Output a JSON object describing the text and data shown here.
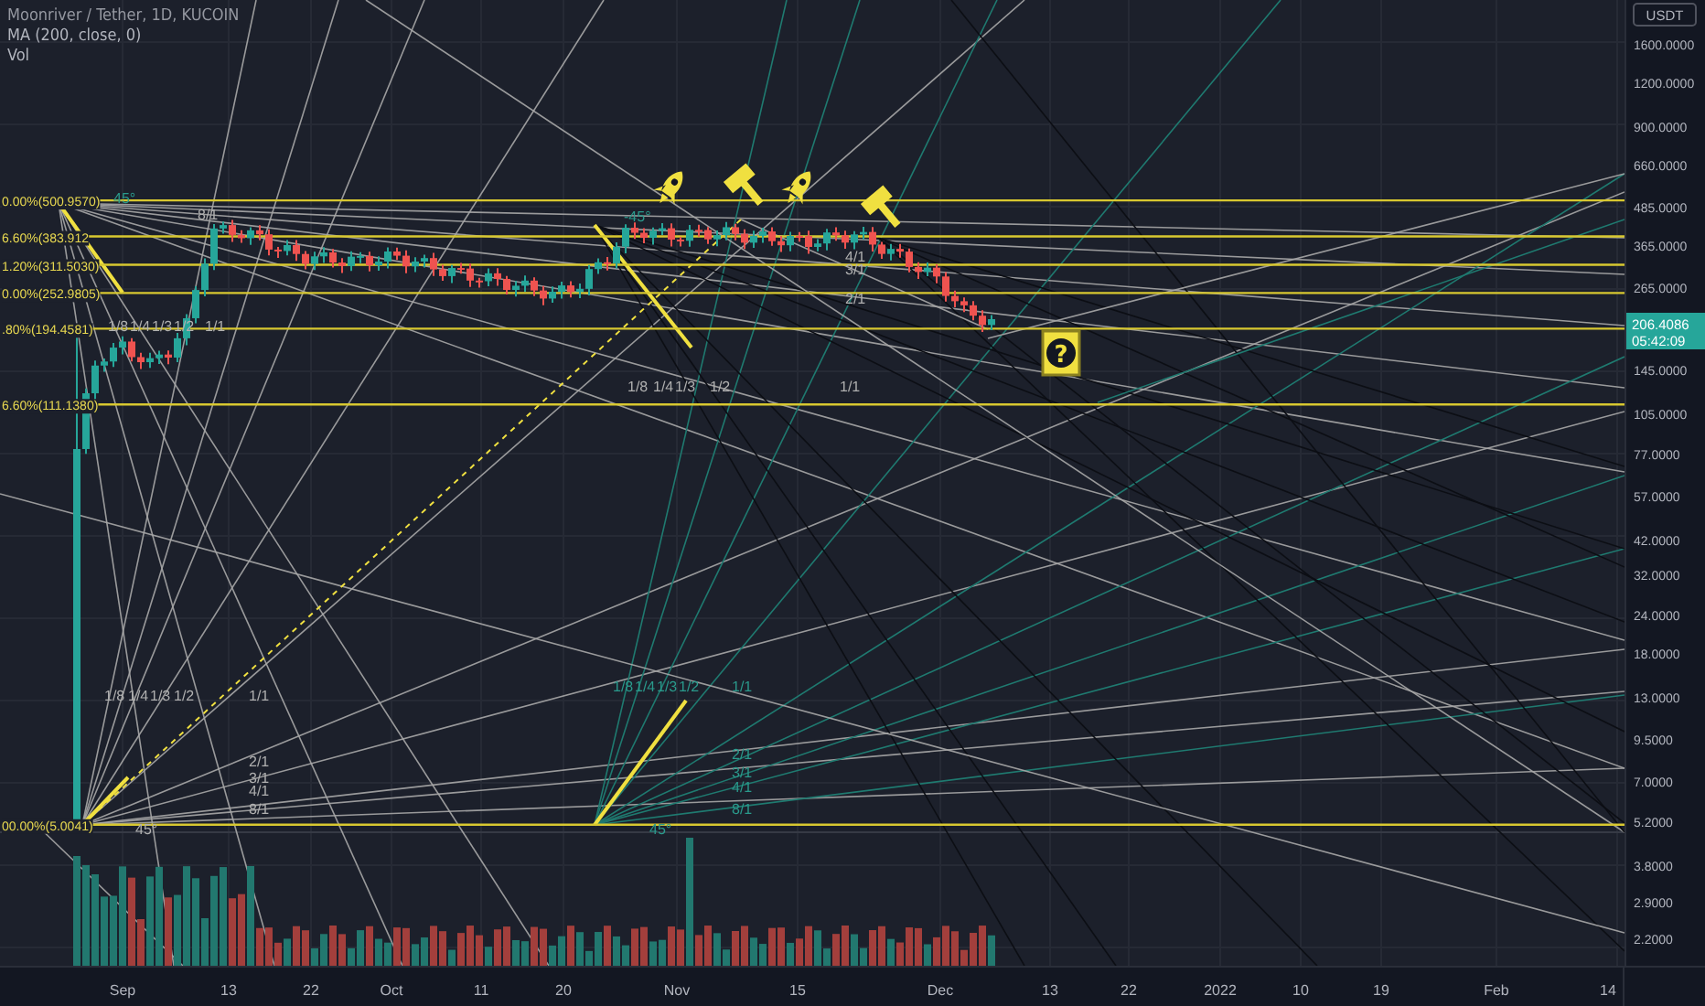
{
  "chart": {
    "legend": [
      "Moonriver / Tether, 1D, KUCOIN",
      "MA (200, close, 0)",
      "Vol"
    ],
    "fib_levels": [
      {
        "label": "0.00%(500.9570)"
      },
      {
        "label": "6.60%(383.912"
      },
      {
        "label": "1.20%(311.5030)"
      },
      {
        "label": "0.00%(252.9805)"
      },
      {
        "label": ".80%(194.4581)"
      },
      {
        "label": "6.60%(111.1380)"
      },
      {
        "label": "00.00%(5.0041)"
      }
    ],
    "fan_labels": [
      "1/8",
      "1/4",
      "1/3",
      "1/2",
      "1/1",
      "2/1",
      "3/1",
      "4/1",
      "8/1",
      "45°",
      "1/8",
      "1/4",
      "1/3",
      "1/2",
      "1/1",
      "2/1",
      "3/1",
      "4/1",
      "8/1",
      "45°",
      "8/1",
      "1/8",
      "1/4",
      "1/3",
      "1/2",
      "1/1",
      "45°",
      "-45°",
      "4/1",
      "3/1",
      "2/1",
      "1/8",
      "1/4",
      "1/3",
      "1/2",
      "1/1"
    ],
    "markers": [
      {
        "kind": "rocket"
      },
      {
        "kind": "hammer"
      },
      {
        "kind": "rocket"
      },
      {
        "kind": "hammer"
      },
      {
        "kind": "question",
        "text": "?"
      }
    ]
  },
  "price_axis": {
    "currency": "USDT",
    "labels": [
      "1600.0000",
      "1200.0000",
      "900.0000",
      "660.0000",
      "485.0000",
      "365.0000",
      "265.0000",
      "145.0000",
      "105.0000",
      "77.0000",
      "57.0000",
      "42.0000",
      "32.0000",
      "24.0000",
      "18.0000",
      "13.0000",
      "9.5000",
      "7.0000",
      "5.2000",
      "3.8000",
      "2.9000",
      "2.2000"
    ],
    "last_price": "206.4086",
    "countdown": "05:42:09"
  },
  "time_axis": {
    "labels": [
      "Sep",
      "13",
      "22",
      "Oct",
      "11",
      "20",
      "Nov",
      "15",
      "Dec",
      "13",
      "22",
      "2022",
      "10",
      "19",
      "Feb",
      "14"
    ]
  }
}
